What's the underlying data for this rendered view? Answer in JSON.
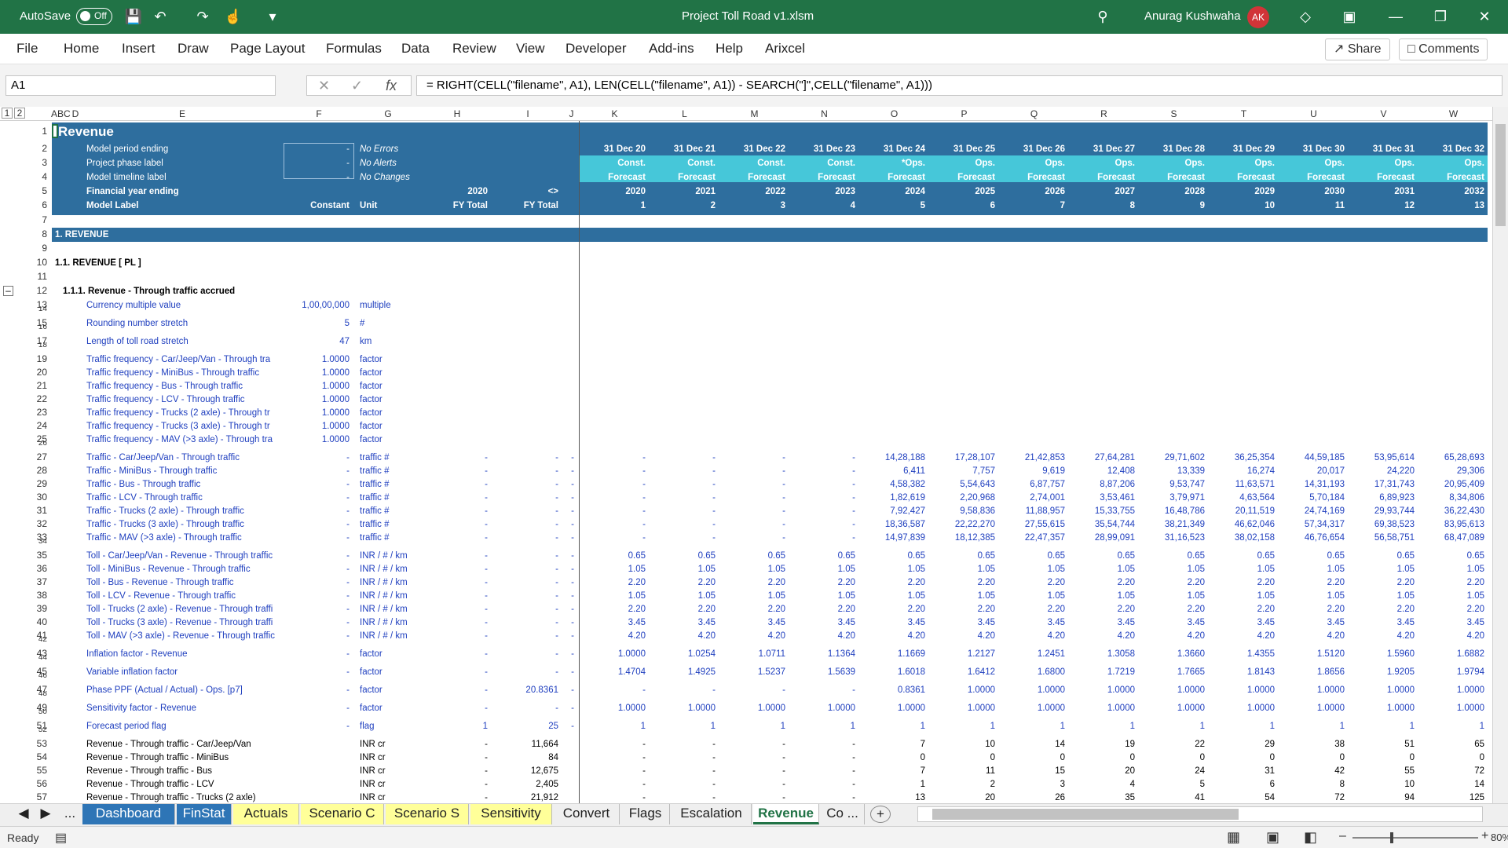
{
  "titlebar": {
    "autosave": "AutoSave",
    "toggle": "Off",
    "filename": "Project Toll Road v1.xlsm",
    "user": "Anurag Kushwaha",
    "initials": "AK"
  },
  "ribbon": {
    "menus": [
      "File",
      "Home",
      "Insert",
      "Draw",
      "Page Layout",
      "Formulas",
      "Data",
      "Review",
      "View",
      "Developer",
      "Add-ins",
      "Help",
      "Arixcel"
    ],
    "share": "Share",
    "comments": "Comments"
  },
  "formulabar": {
    "namebox": "A1",
    "formula": "= RIGHT(CELL(\"filename\", A1), LEN(CELL(\"filename\", A1)) - SEARCH(\"]\",CELL(\"filename\", A1)))"
  },
  "columns": [
    "A",
    "B",
    "C",
    "D",
    "E",
    "F",
    "G",
    "H",
    "I",
    "J",
    "K",
    "L",
    "M",
    "N",
    "O",
    "P",
    "Q",
    "R",
    "S",
    "T",
    "U",
    "V",
    "W"
  ],
  "outline_levels": [
    "1",
    "2"
  ],
  "header": {
    "title": "Revenue",
    "labels": [
      "Model period ending",
      "Project phase label",
      "Model timeline label",
      "Financial year ending",
      "Model Label"
    ],
    "fdash": "-",
    "status": [
      "No Errors",
      "No Alerts",
      "No Changes"
    ],
    "row5_h": "2020",
    "row5_i": "<>",
    "row6_f": "Constant",
    "row6_g": "Unit",
    "row6_h": "FY Total",
    "row6_i": "FY Total",
    "dates": [
      "31 Dec 20",
      "31 Dec 21",
      "31 Dec 22",
      "31 Dec 23",
      "31 Dec 24",
      "31 Dec 25",
      "31 Dec 26",
      "31 Dec 27",
      "31 Dec 28",
      "31 Dec 29",
      "31 Dec 30",
      "31 Dec 31",
      "31 Dec 32"
    ],
    "phases": [
      "Const.",
      "Const.",
      "Const.",
      "Const.",
      "*Ops.",
      "Ops.",
      "Ops.",
      "Ops.",
      "Ops.",
      "Ops.",
      "Ops.",
      "Ops.",
      "Ops."
    ],
    "timeline": [
      "Forecast",
      "Forecast",
      "Forecast",
      "Forecast",
      "Forecast",
      "Forecast",
      "Forecast",
      "Forecast",
      "Forecast",
      "Forecast",
      "Forecast",
      "Forecast",
      "Forecast"
    ],
    "years": [
      "2020",
      "2021",
      "2022",
      "2023",
      "2024",
      "2025",
      "2026",
      "2027",
      "2028",
      "2029",
      "2030",
      "2031",
      "2032"
    ],
    "labels_row": [
      "1",
      "2",
      "3",
      "4",
      "5",
      "6",
      "7",
      "8",
      "9",
      "10",
      "11",
      "12",
      "13"
    ]
  },
  "sections": {
    "s1": "1. REVENUE",
    "s11": "1.1. REVENUE [ PL ]",
    "s111": "1.1.1. Revenue - Through traffic accrued",
    "s1_row": "8",
    "s11_row": "10",
    "s111_row": "12"
  },
  "rows": [
    {
      "r": "13",
      "e": "Currency multiple value",
      "f": "1,00,00,000",
      "g": "multiple",
      "h": "",
      "i": "",
      "j": "",
      "v": []
    },
    {
      "r": "15",
      "e": "Rounding number  stretch",
      "f": "5",
      "g": "#",
      "h": "",
      "i": "",
      "j": "",
      "v": []
    },
    {
      "r": "17",
      "e": "Length of toll road  stretch",
      "f": "47",
      "g": "km",
      "h": "",
      "i": "",
      "j": "",
      "v": []
    },
    {
      "r": "19",
      "e": "Traffic frequency - Car/Jeep/Van  - Through tra",
      "f": "1.0000",
      "g": "factor",
      "h": "",
      "i": "",
      "j": "",
      "v": []
    },
    {
      "r": "20",
      "e": "Traffic frequency - MiniBus  - Through traffic",
      "f": "1.0000",
      "g": "factor",
      "h": "",
      "i": "",
      "j": "",
      "v": []
    },
    {
      "r": "21",
      "e": "Traffic frequency - Bus  - Through traffic",
      "f": "1.0000",
      "g": "factor",
      "h": "",
      "i": "",
      "j": "",
      "v": []
    },
    {
      "r": "22",
      "e": "Traffic frequency - LCV  - Through traffic",
      "f": "1.0000",
      "g": "factor",
      "h": "",
      "i": "",
      "j": "",
      "v": []
    },
    {
      "r": "23",
      "e": "Traffic frequency - Trucks (2 axle)  - Through tr",
      "f": "1.0000",
      "g": "factor",
      "h": "",
      "i": "",
      "j": "",
      "v": []
    },
    {
      "r": "24",
      "e": "Traffic frequency - Trucks (3 axle)  - Through tr",
      "f": "1.0000",
      "g": "factor",
      "h": "",
      "i": "",
      "j": "",
      "v": []
    },
    {
      "r": "25",
      "e": "Traffic frequency - MAV (>3 axle)  - Through tra",
      "f": "1.0000",
      "g": "factor",
      "h": "",
      "i": "",
      "j": "",
      "v": []
    },
    {
      "r": "27",
      "e": "Traffic - Car/Jeep/Van  - Through traffic",
      "f": "-",
      "g": "traffic #",
      "h": "-",
      "i": "-",
      "j": "-",
      "v": [
        "-",
        "-",
        "-",
        "-",
        "14,28,188",
        "17,28,107",
        "21,42,853",
        "27,64,281",
        "29,71,602",
        "36,25,354",
        "44,59,185",
        "53,95,614",
        "65,28,693"
      ]
    },
    {
      "r": "28",
      "e": "Traffic - MiniBus  - Through traffic",
      "f": "-",
      "g": "traffic #",
      "h": "-",
      "i": "-",
      "j": "-",
      "v": [
        "-",
        "-",
        "-",
        "-",
        "6,411",
        "7,757",
        "9,619",
        "12,408",
        "13,339",
        "16,274",
        "20,017",
        "24,220",
        "29,306"
      ]
    },
    {
      "r": "29",
      "e": "Traffic - Bus  - Through traffic",
      "f": "-",
      "g": "traffic #",
      "h": "-",
      "i": "-",
      "j": "-",
      "v": [
        "-",
        "-",
        "-",
        "-",
        "4,58,382",
        "5,54,643",
        "6,87,757",
        "8,87,206",
        "9,53,747",
        "11,63,571",
        "14,31,193",
        "17,31,743",
        "20,95,409"
      ]
    },
    {
      "r": "30",
      "e": "Traffic - LCV  - Through traffic",
      "f": "-",
      "g": "traffic #",
      "h": "-",
      "i": "-",
      "j": "-",
      "v": [
        "-",
        "-",
        "-",
        "-",
        "1,82,619",
        "2,20,968",
        "2,74,001",
        "3,53,461",
        "3,79,971",
        "4,63,564",
        "5,70,184",
        "6,89,923",
        "8,34,806"
      ]
    },
    {
      "r": "31",
      "e": "Traffic - Trucks (2 axle)  - Through traffic",
      "f": "-",
      "g": "traffic #",
      "h": "-",
      "i": "-",
      "j": "-",
      "v": [
        "-",
        "-",
        "-",
        "-",
        "7,92,427",
        "9,58,836",
        "11,88,957",
        "15,33,755",
        "16,48,786",
        "20,11,519",
        "24,74,169",
        "29,93,744",
        "36,22,430"
      ]
    },
    {
      "r": "32",
      "e": "Traffic - Trucks (3 axle)  - Through traffic",
      "f": "-",
      "g": "traffic #",
      "h": "-",
      "i": "-",
      "j": "-",
      "v": [
        "-",
        "-",
        "-",
        "-",
        "18,36,587",
        "22,22,270",
        "27,55,615",
        "35,54,744",
        "38,21,349",
        "46,62,046",
        "57,34,317",
        "69,38,523",
        "83,95,613"
      ]
    },
    {
      "r": "33",
      "e": "Traffic - MAV (>3 axle)  - Through traffic",
      "f": "-",
      "g": "traffic #",
      "h": "-",
      "i": "-",
      "j": "-",
      "v": [
        "-",
        "-",
        "-",
        "-",
        "14,97,839",
        "18,12,385",
        "22,47,357",
        "28,99,091",
        "31,16,523",
        "38,02,158",
        "46,76,654",
        "56,58,751",
        "68,47,089"
      ]
    },
    {
      "r": "35",
      "e": "Toll - Car/Jeep/Van - Revenue - Through traffic",
      "f": "-",
      "g": "INR / # / km",
      "h": "-",
      "i": "-",
      "j": "-",
      "v": [
        "0.65",
        "0.65",
        "0.65",
        "0.65",
        "0.65",
        "0.65",
        "0.65",
        "0.65",
        "0.65",
        "0.65",
        "0.65",
        "0.65",
        "0.65"
      ]
    },
    {
      "r": "36",
      "e": "Toll - MiniBus - Revenue - Through traffic",
      "f": "-",
      "g": "INR / # / km",
      "h": "-",
      "i": "-",
      "j": "-",
      "v": [
        "1.05",
        "1.05",
        "1.05",
        "1.05",
        "1.05",
        "1.05",
        "1.05",
        "1.05",
        "1.05",
        "1.05",
        "1.05",
        "1.05",
        "1.05"
      ]
    },
    {
      "r": "37",
      "e": "Toll - Bus - Revenue - Through traffic",
      "f": "-",
      "g": "INR / # / km",
      "h": "-",
      "i": "-",
      "j": "-",
      "v": [
        "2.20",
        "2.20",
        "2.20",
        "2.20",
        "2.20",
        "2.20",
        "2.20",
        "2.20",
        "2.20",
        "2.20",
        "2.20",
        "2.20",
        "2.20"
      ]
    },
    {
      "r": "38",
      "e": "Toll - LCV - Revenue - Through traffic",
      "f": "-",
      "g": "INR / # / km",
      "h": "-",
      "i": "-",
      "j": "-",
      "v": [
        "1.05",
        "1.05",
        "1.05",
        "1.05",
        "1.05",
        "1.05",
        "1.05",
        "1.05",
        "1.05",
        "1.05",
        "1.05",
        "1.05",
        "1.05"
      ]
    },
    {
      "r": "39",
      "e": "Toll - Trucks (2 axle) - Revenue - Through traffi",
      "f": "-",
      "g": "INR / # / km",
      "h": "-",
      "i": "-",
      "j": "-",
      "v": [
        "2.20",
        "2.20",
        "2.20",
        "2.20",
        "2.20",
        "2.20",
        "2.20",
        "2.20",
        "2.20",
        "2.20",
        "2.20",
        "2.20",
        "2.20"
      ]
    },
    {
      "r": "40",
      "e": "Toll - Trucks (3 axle) - Revenue - Through traffi",
      "f": "-",
      "g": "INR / # / km",
      "h": "-",
      "i": "-",
      "j": "-",
      "v": [
        "3.45",
        "3.45",
        "3.45",
        "3.45",
        "3.45",
        "3.45",
        "3.45",
        "3.45",
        "3.45",
        "3.45",
        "3.45",
        "3.45",
        "3.45"
      ]
    },
    {
      "r": "41",
      "e": "Toll - MAV (>3 axle) - Revenue - Through traffic",
      "f": "-",
      "g": "INR / # / km",
      "h": "-",
      "i": "-",
      "j": "-",
      "v": [
        "4.20",
        "4.20",
        "4.20",
        "4.20",
        "4.20",
        "4.20",
        "4.20",
        "4.20",
        "4.20",
        "4.20",
        "4.20",
        "4.20",
        "4.20"
      ]
    },
    {
      "r": "43",
      "e": "Inflation factor - Revenue",
      "f": "-",
      "g": "factor",
      "h": "-",
      "i": "-",
      "j": "-",
      "v": [
        "1.0000",
        "1.0254",
        "1.0711",
        "1.1364",
        "1.1669",
        "1.2127",
        "1.2451",
        "1.3058",
        "1.3660",
        "1.4355",
        "1.5120",
        "1.5960",
        "1.6882"
      ]
    },
    {
      "r": "45",
      "e": "Variable inflation factor",
      "f": "-",
      "g": "factor",
      "h": "-",
      "i": "-",
      "j": "-",
      "v": [
        "1.4704",
        "1.4925",
        "1.5237",
        "1.5639",
        "1.6018",
        "1.6412",
        "1.6800",
        "1.7219",
        "1.7665",
        "1.8143",
        "1.8656",
        "1.9205",
        "1.9794"
      ]
    },
    {
      "r": "47",
      "e": "Phase PPF (Actual / Actual) - Ops. [p7]",
      "f": "-",
      "g": "factor",
      "h": "-",
      "i": "20.8361",
      "j": "-",
      "v": [
        "-",
        "-",
        "-",
        "-",
        "0.8361",
        "1.0000",
        "1.0000",
        "1.0000",
        "1.0000",
        "1.0000",
        "1.0000",
        "1.0000",
        "1.0000"
      ]
    },
    {
      "r": "49",
      "e": "Sensitivity factor - Revenue",
      "f": "-",
      "g": "factor",
      "h": "-",
      "i": "-",
      "j": "-",
      "v": [
        "1.0000",
        "1.0000",
        "1.0000",
        "1.0000",
        "1.0000",
        "1.0000",
        "1.0000",
        "1.0000",
        "1.0000",
        "1.0000",
        "1.0000",
        "1.0000",
        "1.0000"
      ]
    },
    {
      "r": "51",
      "e": "Forecast period flag",
      "f": "-",
      "g": "flag",
      "h": "1",
      "i": "25",
      "j": "-",
      "v": [
        "1",
        "1",
        "1",
        "1",
        "1",
        "1",
        "1",
        "1",
        "1",
        "1",
        "1",
        "1",
        "1"
      ]
    },
    {
      "r": "53",
      "e": "Revenue - Through traffic - Car/Jeep/Van",
      "f": "",
      "g": "INR cr",
      "h": "-",
      "i": "11,664",
      "j": "",
      "v": [
        "-",
        "-",
        "-",
        "-",
        "7",
        "10",
        "14",
        "19",
        "22",
        "29",
        "38",
        "51",
        "65"
      ],
      "black": true
    },
    {
      "r": "54",
      "e": "Revenue - Through traffic - MiniBus",
      "f": "",
      "g": "INR cr",
      "h": "-",
      "i": "84",
      "j": "",
      "v": [
        "-",
        "-",
        "-",
        "-",
        "0",
        "0",
        "0",
        "0",
        "0",
        "0",
        "0",
        "0",
        "0"
      ],
      "black": true
    },
    {
      "r": "55",
      "e": "Revenue - Through traffic - Bus",
      "f": "",
      "g": "INR cr",
      "h": "-",
      "i": "12,675",
      "j": "",
      "v": [
        "-",
        "-",
        "-",
        "-",
        "7",
        "11",
        "15",
        "20",
        "24",
        "31",
        "42",
        "55",
        "72"
      ],
      "black": true
    },
    {
      "r": "56",
      "e": "Revenue - Through traffic - LCV",
      "f": "",
      "g": "INR cr",
      "h": "-",
      "i": "2,405",
      "j": "",
      "v": [
        "-",
        "-",
        "-",
        "-",
        "1",
        "2",
        "3",
        "4",
        "5",
        "6",
        "8",
        "10",
        "14"
      ],
      "black": true
    },
    {
      "r": "57",
      "e": "Revenue - Through traffic - Trucks (2 axle)",
      "f": "",
      "g": "INR cr",
      "h": "-",
      "i": "21,912",
      "j": "",
      "v": [
        "-",
        "-",
        "-",
        "-",
        "13",
        "20",
        "26",
        "35",
        "41",
        "54",
        "72",
        "94",
        "125"
      ],
      "black": true
    }
  ],
  "sheet_tabs": [
    "Dashboard",
    "FinStat",
    "Actuals",
    "Scenario C",
    "Scenario S",
    "Sensitivity",
    "Convert",
    "Flags",
    "Escalation",
    "Revenue",
    "Co ..."
  ],
  "tab_colors": {
    "Dashboard": "#2e75b6",
    "FinStat": "#2e75b6",
    "Actuals": "#ffff99",
    "Scenario C": "#ffff99",
    "Scenario S": "#ffff99",
    "Sensitivity": "#ffff99"
  },
  "status": {
    "ready": "Ready",
    "zoom": "80%"
  },
  "colors": {
    "band": "#2e6e9e",
    "accent": "#217346",
    "cyan": "#46c7d9"
  }
}
